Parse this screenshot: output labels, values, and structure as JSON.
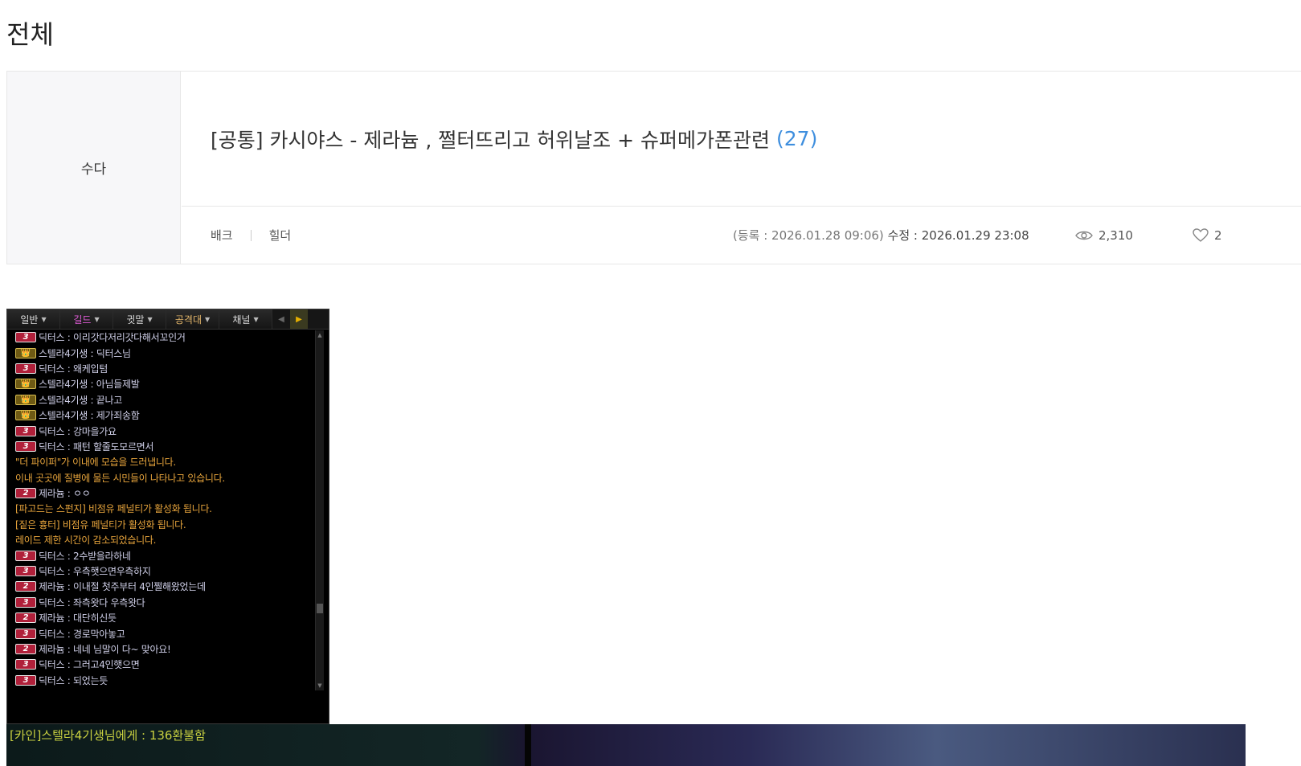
{
  "page": {
    "title": "전체"
  },
  "post": {
    "category": "수다",
    "title": "[공통] 카시야스 - 제라늄 , 쩔터뜨리고 허위날조 + 슈퍼메가폰관련",
    "comment_count": "(27)",
    "server": "배크",
    "job": "힐더",
    "registered_label": "(등록 : 2026.01.28 09:06)",
    "modified_label": "수정 : 2026.01.29 23:08",
    "views": "2,310",
    "likes": "2"
  },
  "icons": {
    "views": "eye-icon",
    "likes": "heart-icon"
  },
  "colors": {
    "accent": "#3e8ede",
    "badge_red": "#b0203a",
    "badge_gold": "#d9bf50",
    "system_text": "#e8a53c"
  },
  "chat": {
    "tabs": [
      {
        "label": "일반",
        "type": "normal"
      },
      {
        "label": "길드",
        "type": "guild"
      },
      {
        "label": "귓말",
        "type": "normal"
      },
      {
        "label": "공격대",
        "type": "raid"
      },
      {
        "label": "채널",
        "type": "normal"
      }
    ],
    "lines": [
      {
        "badge": "3",
        "badge_style": "red",
        "text": "딕터스 : 이리갓다저리갓다해서꼬인거"
      },
      {
        "badge": "👑",
        "badge_style": "gold",
        "text": "스텔라4기생 : 딕터스님"
      },
      {
        "badge": "3",
        "badge_style": "red",
        "text": "딕터스 : 왜케입텀"
      },
      {
        "badge": "👑",
        "badge_style": "gold",
        "text": "스텔라4기생 : 아님들제발"
      },
      {
        "badge": "👑",
        "badge_style": "gold",
        "text": "스텔라4기생 : 끝나고"
      },
      {
        "badge": "👑",
        "badge_style": "gold",
        "text": "스텔라4기생 : 제가죄송함"
      },
      {
        "badge": "3",
        "badge_style": "red",
        "text": "딕터스 : 강마을가요"
      },
      {
        "badge": "3",
        "badge_style": "red",
        "text": "딕터스 : 패턴 할줄도모르면서"
      },
      {
        "badge": "",
        "badge_style": "",
        "text": "\"더 파이퍼\"가 이내에 모습을 드러냅니다."
      },
      {
        "badge": "",
        "badge_style": "",
        "text": "이내 곳곳에 질병에 물든 시민들이 나타나고 있습니다."
      },
      {
        "badge": "2",
        "badge_style": "red",
        "text": "제라늄 : ㅇㅇ"
      },
      {
        "badge": "",
        "badge_style": "",
        "text": "[파고드는 스펀지] 비점유 페널티가 활성화 됩니다."
      },
      {
        "badge": "",
        "badge_style": "",
        "text": "[짙은 흉터] 비점유 페널티가 활성화 됩니다."
      },
      {
        "badge": "",
        "badge_style": "",
        "text": "레이드 제한 시간이 감소되었습니다."
      },
      {
        "badge": "3",
        "badge_style": "red",
        "text": "딕터스 : 2수받을라하네"
      },
      {
        "badge": "3",
        "badge_style": "red",
        "text": "딕터스 : 우측햇으면우측하지"
      },
      {
        "badge": "2",
        "badge_style": "red",
        "text": "제라늄 : 이내절 첫주부터 4인쩔해왔었는데"
      },
      {
        "badge": "3",
        "badge_style": "red",
        "text": "딕터스 : 좌측왓다 우측왓다"
      },
      {
        "badge": "2",
        "badge_style": "red",
        "text": "제라늄 : 대단히신듯"
      },
      {
        "badge": "3",
        "badge_style": "red",
        "text": "딕터스 : 경로막아놓고"
      },
      {
        "badge": "2",
        "badge_style": "red",
        "text": "제라늄 : 네네 님말이 다~ 맞아요!"
      },
      {
        "badge": "3",
        "badge_style": "red",
        "text": "딕터스 : 그러고4인햇으면"
      },
      {
        "badge": "3",
        "badge_style": "red",
        "text": "딕터스 : 되었는듯"
      }
    ]
  },
  "game": {
    "whisper": "[카인]스텔라4기생님에게 : 136환불함"
  }
}
